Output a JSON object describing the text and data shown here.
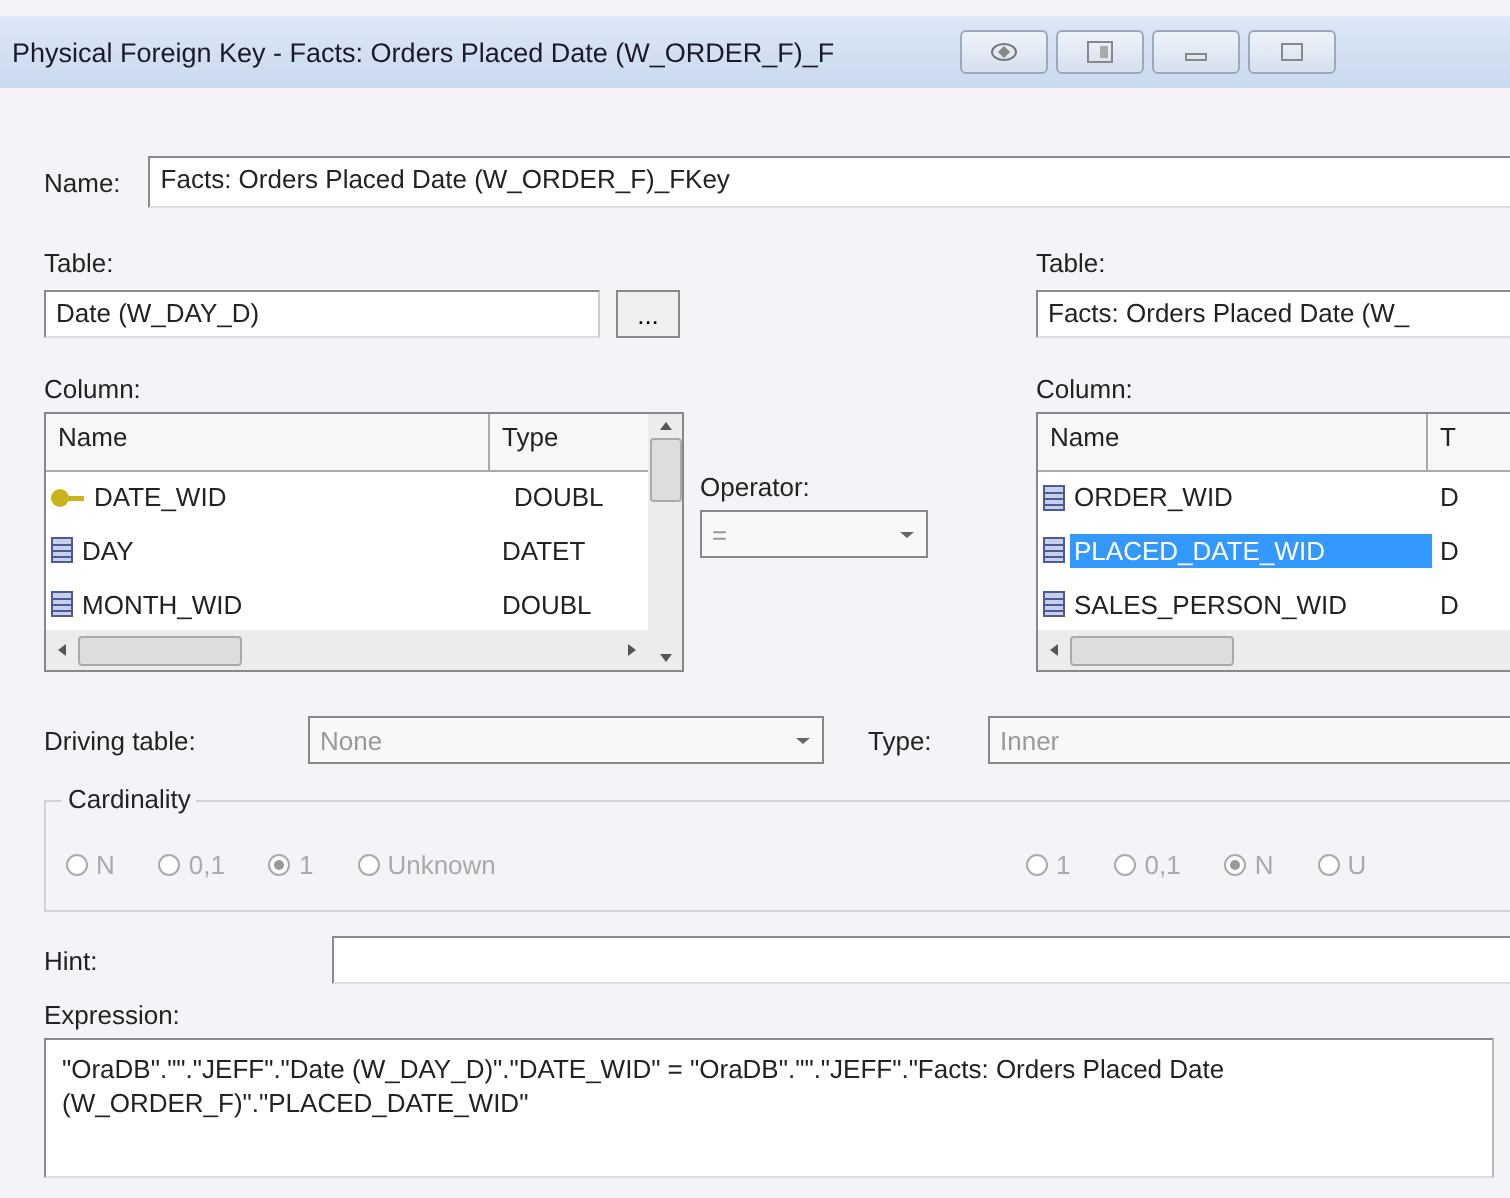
{
  "window": {
    "title": "Physical Foreign Key - Facts: Orders Placed Date (W_ORDER_F)_F",
    "buttons": [
      {
        "kind": "back"
      },
      {
        "kind": "layout"
      },
      {
        "kind": "minimize"
      },
      {
        "kind": "maximize"
      }
    ]
  },
  "name": {
    "label": "Name:",
    "value": "Facts: Orders Placed Date (W_ORDER_F)_FKey"
  },
  "source": {
    "table_label": "Table:",
    "table_value": "Date (W_DAY_D)",
    "browse": "...",
    "column_label": "Column:",
    "columns": [
      "Name",
      "Type"
    ],
    "rows": [
      {
        "kind": "key",
        "name": "DATE_WID",
        "type": "DOUBL",
        "selected": false
      },
      {
        "kind": "column",
        "name": "DAY",
        "type": "DATET",
        "selected": false
      },
      {
        "kind": "column",
        "name": "MONTH_WID",
        "type": "DOUBL",
        "selected": false
      }
    ]
  },
  "operator": {
    "label": "Operator:",
    "value": "=",
    "disabled": true
  },
  "target": {
    "table_label": "Table:",
    "table_value": "Facts: Orders Placed Date (W_",
    "column_label": "Column:",
    "columns": [
      "Name",
      "T"
    ],
    "rows": [
      {
        "kind": "column",
        "name": "ORDER_WID",
        "type": "D",
        "selected": false
      },
      {
        "kind": "column",
        "name": "PLACED_DATE_WID",
        "type": "D",
        "selected": true
      },
      {
        "kind": "column",
        "name": "SALES_PERSON_WID",
        "type": "D",
        "selected": false
      }
    ]
  },
  "driving_table": {
    "label": "Driving table:",
    "value": "None",
    "disabled": true
  },
  "join_type": {
    "label": "Type:",
    "value": "Inner",
    "disabled": true
  },
  "cardinality": {
    "label": "Cardinality",
    "disabled": true,
    "left": [
      {
        "label": "N",
        "selected": false
      },
      {
        "label": "0,1",
        "selected": false
      },
      {
        "label": "1",
        "selected": true
      },
      {
        "label": "Unknown",
        "selected": false
      }
    ],
    "right": [
      {
        "label": "1",
        "selected": false
      },
      {
        "label": "0,1",
        "selected": false
      },
      {
        "label": "N",
        "selected": true
      },
      {
        "label": "U",
        "selected": false
      }
    ]
  },
  "hint": {
    "label": "Hint:"
  },
  "expression": {
    "label": "Expression:",
    "value": "\"OraDB\".\"\".\"JEFF\".\"Date (W_DAY_D)\".\"DATE_WID\" = \"OraDB\".\"\".\"JEFF\".\"Facts: Orders Placed Date (W_ORDER_F)\".\"PLACED_DATE_WID\""
  }
}
